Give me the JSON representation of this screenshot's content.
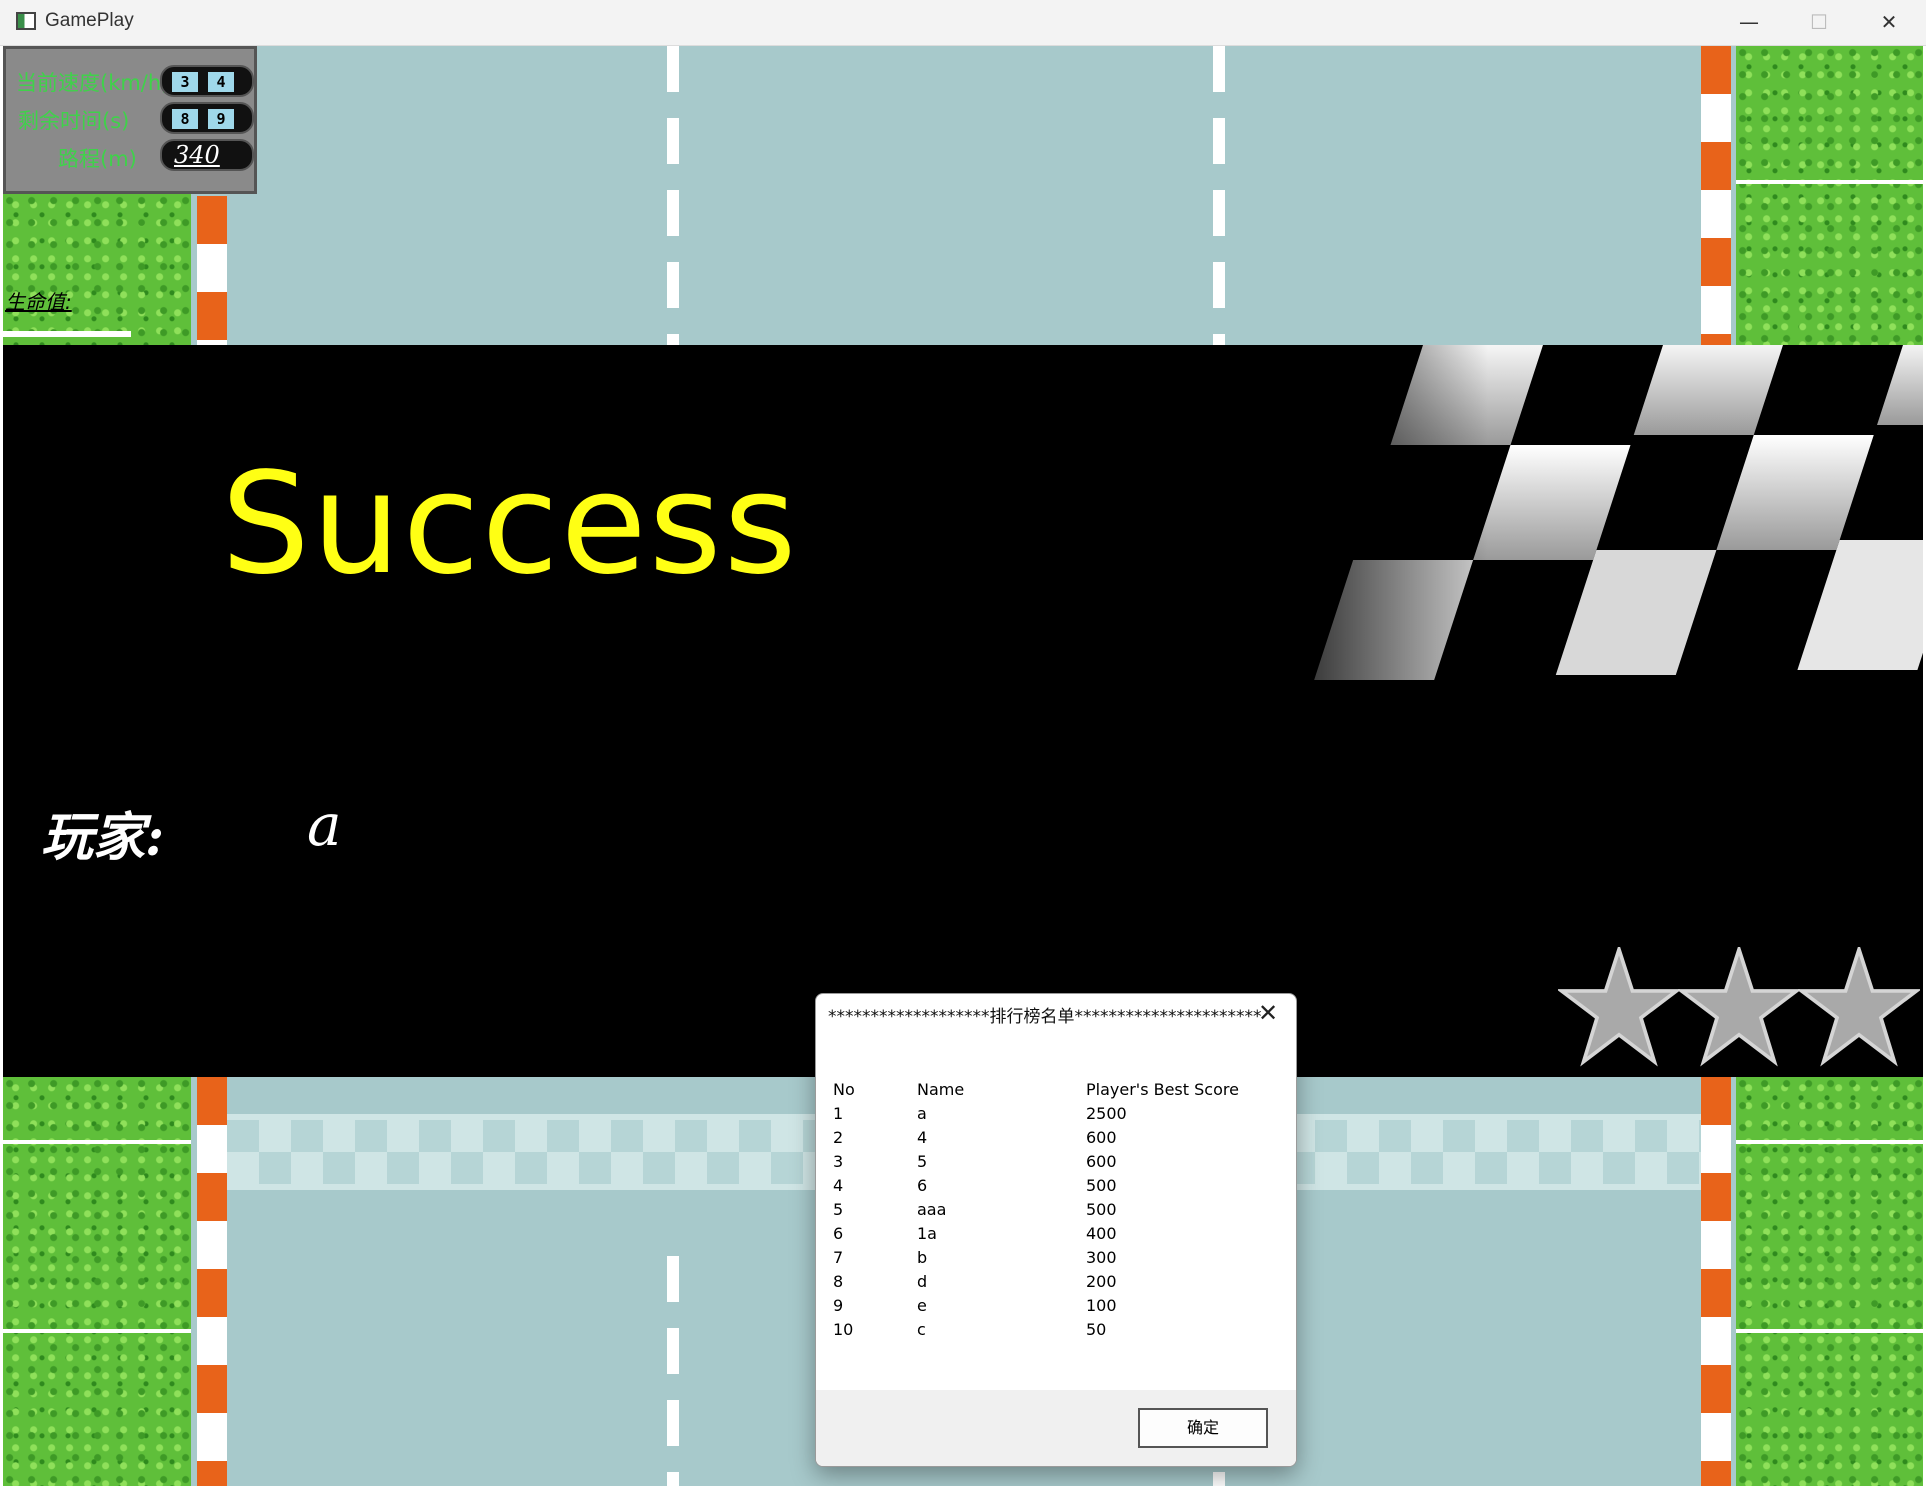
{
  "window": {
    "title": "GamePlay",
    "minimize_glyph": "—",
    "maximize_glyph": "☐",
    "close_glyph": "✕"
  },
  "hud": {
    "speed_label": "当前速度(km/h)",
    "speed_digits": [
      "3",
      "4"
    ],
    "time_label": "剩余时间(s)",
    "time_digits": [
      "8",
      "9"
    ],
    "distance_label": "路程(m)",
    "distance_value": "340"
  },
  "life_label": "生命值:",
  "banner": {
    "success_text": "Success",
    "player_label": "玩家:",
    "player_name": "a",
    "stars_earned": 3
  },
  "dialog": {
    "title": "*******************排行榜名单**********************",
    "close_glyph": "✕",
    "headers": {
      "no": "No",
      "name": "Name",
      "score": "Player's Best Score"
    },
    "rows": [
      {
        "no": "1",
        "name": "a",
        "score": "2500"
      },
      {
        "no": "2",
        "name": "4",
        "score": "600"
      },
      {
        "no": "3",
        "name": "5",
        "score": "600"
      },
      {
        "no": "4",
        "name": "6",
        "score": "500"
      },
      {
        "no": "5",
        "name": "aaa",
        "score": "500"
      },
      {
        "no": "6",
        "name": "1a",
        "score": "400"
      },
      {
        "no": "7",
        "name": "b",
        "score": "300"
      },
      {
        "no": "8",
        "name": "d",
        "score": "200"
      },
      {
        "no": "9",
        "name": "e",
        "score": "100"
      },
      {
        "no": "10",
        "name": "c",
        "score": "50"
      }
    ],
    "ok_label": "确定"
  },
  "colors": {
    "success_yellow": "#ffff14",
    "road": "#a7c9cb",
    "grass": "#5fbf3a",
    "curb_orange": "#e8631a",
    "hud_green": "#3fd24a",
    "digit_blue": "#9fd8ea",
    "star_gray": "#a9a9a9"
  }
}
